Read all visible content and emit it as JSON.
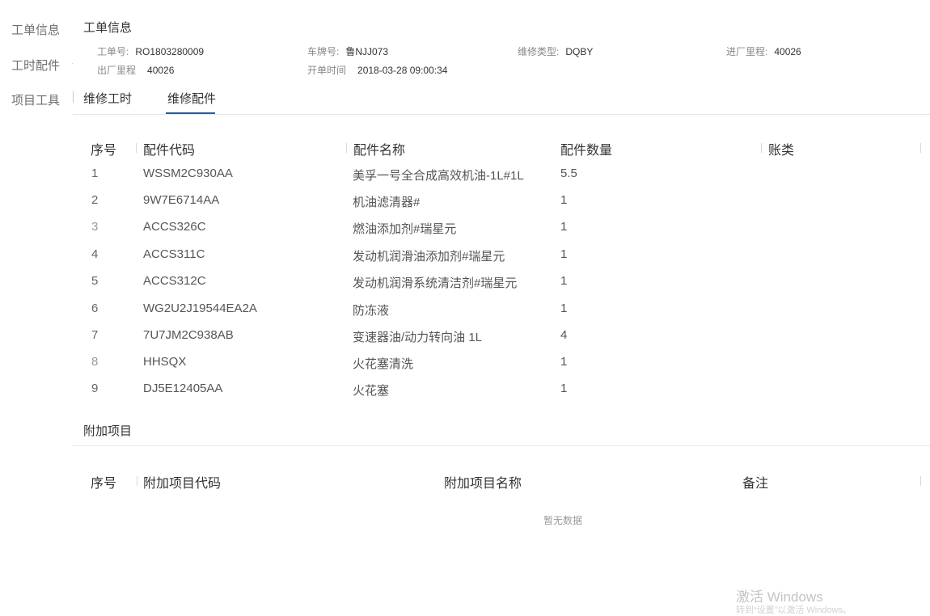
{
  "left_nav": {
    "items": [
      {
        "label": "工单信息"
      },
      {
        "label": "工时配件"
      },
      {
        "label": "项目工具"
      }
    ]
  },
  "order_info": {
    "title": "工单信息",
    "fields": {
      "order_no": {
        "label": "工单号:",
        "value": "RO1803280009"
      },
      "plate_no": {
        "label": "车牌号:",
        "value": "鲁NJJ073"
      },
      "repair_type": {
        "label": "维修类型:",
        "value": "DQBY"
      },
      "mileage_in": {
        "label": "进厂里程:",
        "value": "40026"
      },
      "mileage_out": {
        "label": "出厂里程",
        "value": "40026"
      },
      "open_time": {
        "label": "开单时间",
        "value": "2018-03-28 09:00:34"
      }
    }
  },
  "tabs": [
    {
      "label": "维修工时"
    },
    {
      "label": "维修配件"
    }
  ],
  "parts_table": {
    "headers": [
      "序号",
      "配件代码",
      "配件名称",
      "配件数量",
      "账类"
    ],
    "rows": [
      {
        "idx": "1",
        "code": "WSSM2C930AA",
        "name": "美孚一号全合成高效机油-1L#1L",
        "qty": "5.5",
        "account": ""
      },
      {
        "idx": "2",
        "code": "9W7E6714AA",
        "name": "机油滤清器#",
        "qty": "1",
        "account": ""
      },
      {
        "idx": "3",
        "code": "ACCS326C",
        "name": "燃油添加剂#瑞星元",
        "qty": "1",
        "account": ""
      },
      {
        "idx": "4",
        "code": "ACCS311C",
        "name": "发动机润滑油添加剂#瑞星元",
        "qty": "1",
        "account": ""
      },
      {
        "idx": "5",
        "code": "ACCS312C",
        "name": "发动机润滑系统清洁剂#瑞星元",
        "qty": "1",
        "account": ""
      },
      {
        "idx": "6",
        "code": "WG2U2J19544EA2A",
        "name": "防冻液",
        "qty": "1",
        "account": ""
      },
      {
        "idx": "7",
        "code": "7U7JM2C938AB",
        "name": "变速器油/动力转向油 1L",
        "qty": "4",
        "account": ""
      },
      {
        "idx": "8",
        "code": "HHSQX",
        "name": "火花塞清洗",
        "qty": "1",
        "account": ""
      },
      {
        "idx": "9",
        "code": "DJ5E12405AA",
        "name": "火花塞",
        "qty": "1",
        "account": ""
      }
    ]
  },
  "extra_section": {
    "title": "附加项目",
    "headers": [
      "序号",
      "附加项目代码",
      "附加项目名称",
      "备注"
    ],
    "empty_text": "暂无数据"
  },
  "watermark": {
    "title": "激活 Windows",
    "subtitle": "转到“设置”以激活 Windows。"
  }
}
